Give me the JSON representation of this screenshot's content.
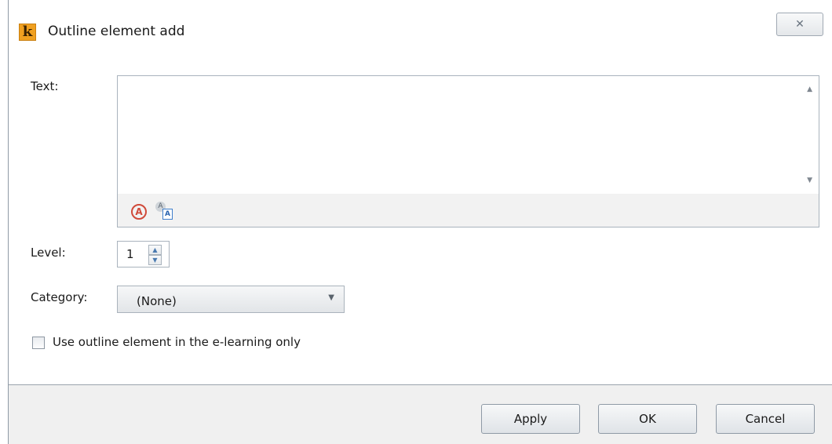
{
  "window": {
    "title": "Outline element add",
    "app_logo_letter": "k",
    "close_glyph": "✕"
  },
  "text_field": {
    "label": "Text:",
    "value": "",
    "tools": {
      "format_icon": "text-format-icon",
      "translate_icon": "translate-icon",
      "format_glyph": "A",
      "translate_glyph_back": "A",
      "translate_glyph_front": "A"
    }
  },
  "level": {
    "label": "Level:",
    "value": "1",
    "up_glyph": "▲",
    "down_glyph": "▼"
  },
  "category": {
    "label": "Category:",
    "selected": "(None)",
    "arrow_glyph": "▼"
  },
  "checkbox": {
    "label": "Use outline element in the e-learning only",
    "checked": false
  },
  "buttons": {
    "apply": "Apply",
    "ok": "OK",
    "cancel": "Cancel"
  },
  "text_scroll": {
    "up_glyph": "▲",
    "down_glyph": "▼"
  }
}
